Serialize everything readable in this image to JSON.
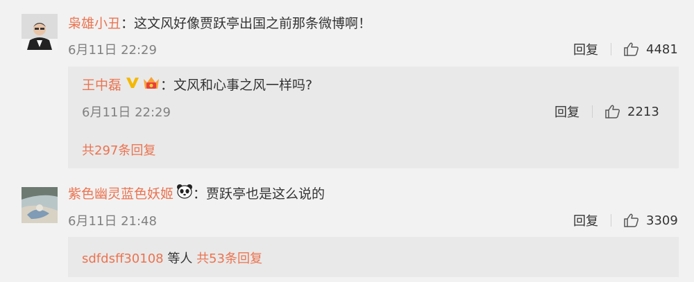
{
  "comments": [
    {
      "username": "枭雄小丑",
      "sep": "：",
      "text": "这文风好像贾跃亭出国之前那条微博啊！",
      "time": "6月11日 22:29",
      "reply_label": "回复",
      "likes": "4481",
      "sub_reply": {
        "username": "王中磊",
        "sep": "：",
        "text": "文风和心事之风一样吗?",
        "time": "6月11日 22:29",
        "reply_label": "回复",
        "likes": "2213"
      },
      "more_replies": "共297条回复"
    },
    {
      "username": "紫色幽灵蓝色妖姬",
      "sep": "：",
      "text": "贾跃亭也是这么说的",
      "time": "6月11日 21:48",
      "reply_label": "回复",
      "likes": "3309",
      "more_user": "sdfdsff30108",
      "more_mid": " 等人 ",
      "more_replies": "共53条回复"
    }
  ],
  "icons": {
    "like": "thumbs-up-icon",
    "verified": "verified-v-icon",
    "vip": "crown-icon",
    "emoji": "panda-icon"
  },
  "colors": {
    "accent": "#eb7350",
    "meta": "#808080",
    "verified": "#f5b800",
    "reply_box": "#e9e9e9"
  }
}
